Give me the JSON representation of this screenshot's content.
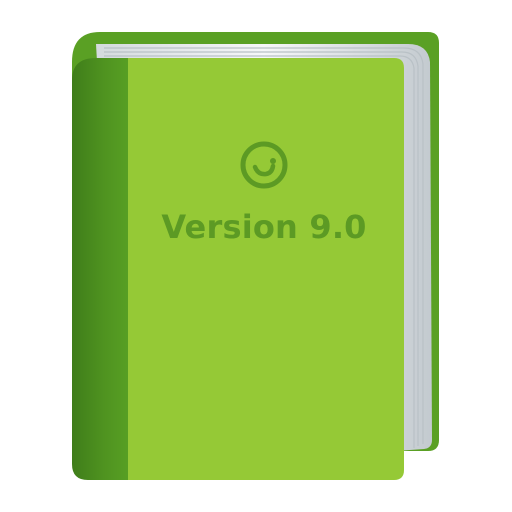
{
  "book": {
    "cover_text": "Version 9.0",
    "logo_icon": "smiley-g-icon"
  },
  "colors": {
    "cover": "#95c936",
    "spine": "#5aa024",
    "spine_shadow": "#3f7d1a",
    "back_cover": "#5aa024",
    "pages": "#f4f6f7",
    "page_edge_shadow": "#c9d0d4",
    "emboss": "#5c9a24"
  }
}
